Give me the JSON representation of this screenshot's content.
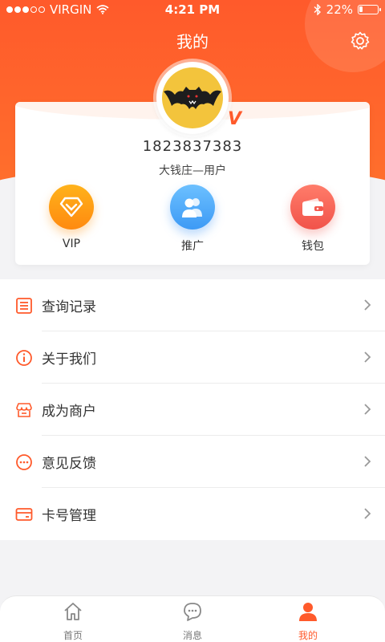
{
  "status_bar": {
    "carrier": "VIRGIN",
    "time": "4:21 PM",
    "battery_percent": "22%",
    "battery_level": 0.22,
    "signal_bars_filled": 3,
    "signal_bars_total": 5
  },
  "header": {
    "title": "我的",
    "settings_icon": "gear-icon"
  },
  "profile": {
    "phone": "1823837383",
    "subtitle": "大钱庄—用户",
    "vip_mark": "V",
    "avatar_icon": "bat-avatar-icon"
  },
  "quick_actions": [
    {
      "label": "VIP",
      "icon": "diamond-icon",
      "color": "#ff9a14"
    },
    {
      "label": "推广",
      "icon": "users-icon",
      "color": "#4aa7fa"
    },
    {
      "label": "钱包",
      "icon": "wallet-icon",
      "color": "#f4584d"
    }
  ],
  "menu": [
    {
      "label": "查询记录",
      "icon": "list-icon"
    },
    {
      "label": "关于我们",
      "icon": "info-icon"
    },
    {
      "label": "成为商户",
      "icon": "shop-icon"
    },
    {
      "label": "意见反馈",
      "icon": "chat-dots-icon"
    },
    {
      "label": "卡号管理",
      "icon": "card-icon"
    }
  ],
  "tabbar": {
    "items": [
      {
        "label": "首页",
        "icon": "home-icon",
        "active": false
      },
      {
        "label": "消息",
        "icon": "message-icon",
        "active": false
      },
      {
        "label": "我的",
        "icon": "person-icon",
        "active": true
      }
    ]
  },
  "colors": {
    "accent": "#ff5a2b",
    "background": "#f3f3f5"
  }
}
